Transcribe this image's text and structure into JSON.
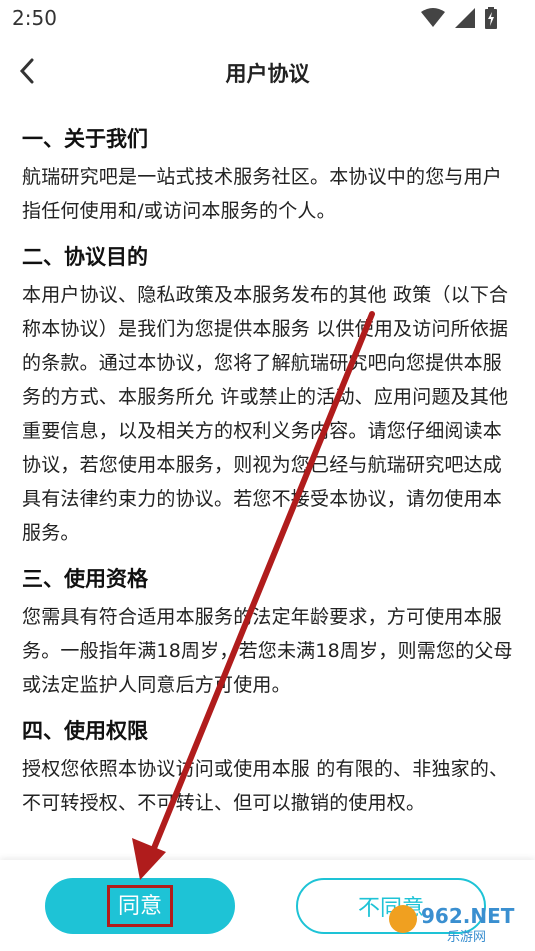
{
  "status_bar": {
    "time": "2:50"
  },
  "header": {
    "title": "用户协议",
    "back_icon": "chevron-left-icon"
  },
  "sections": [
    {
      "heading": "一、关于我们",
      "body": "航瑞研究吧是一站式技术服务社区。本协议中的您与用户指任何使用和/或访问本服务的个人。"
    },
    {
      "heading": "二、协议目的",
      "body": "本用户协议、隐私政策及本服务发布的其他 政策（以下合称本协议）是我们为您提供本服务 以供使用及访问所依据的条款。通过本协议，您将了解航瑞研究吧向您提供本服务的方式、本服务所允 许或禁止的活动、应用问题及其他重要信息，以及相关方的权利义务内容。请您仔细阅读本协议，若您使用本服务，则视为您已经与航瑞研究吧达成具有法律约束力的协议。若您不接受本协议，请勿使用本服务。"
    },
    {
      "heading": "三、使用资格",
      "body": "您需具有符合适用本服务的法定年龄要求，方可使用本服务。一般指年满18周岁，若您未满18周岁，则需您的父母或法定监护人同意后方可使用。"
    },
    {
      "heading": "四、使用权限",
      "body": "授权您依照本协议访问或使用本服 的有限的、非独家的、不可转授权、不可转让、但可以撤销的使用权。"
    }
  ],
  "buttons": {
    "agree": "同意",
    "disagree": "不同意"
  },
  "colors": {
    "accent": "#1ec3d6",
    "annotation": "#b01c1c"
  },
  "watermark": {
    "text": "962.NET",
    "subtext": "乐游网"
  }
}
